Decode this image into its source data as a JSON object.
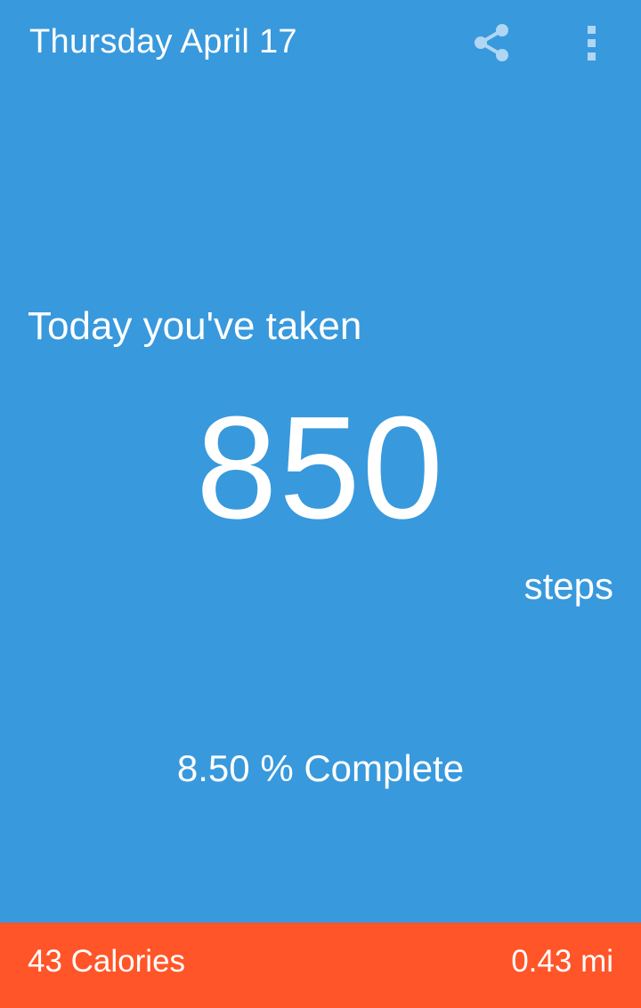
{
  "header": {
    "date_title": "Thursday April 17",
    "share_icon": "share-icon",
    "overflow_icon": "overflow-menu-icon"
  },
  "main": {
    "intro_text": "Today you've taken",
    "step_count": "850",
    "step_unit": "steps",
    "completion_text": "8.50 % Complete",
    "completion_percent": 8.5
  },
  "footer": {
    "calories_text": "43 Calories",
    "distance_text": "0.43 mi"
  },
  "colors": {
    "background": "#3899DD",
    "footer_background": "#FF5528",
    "text": "#FFFFFF"
  }
}
